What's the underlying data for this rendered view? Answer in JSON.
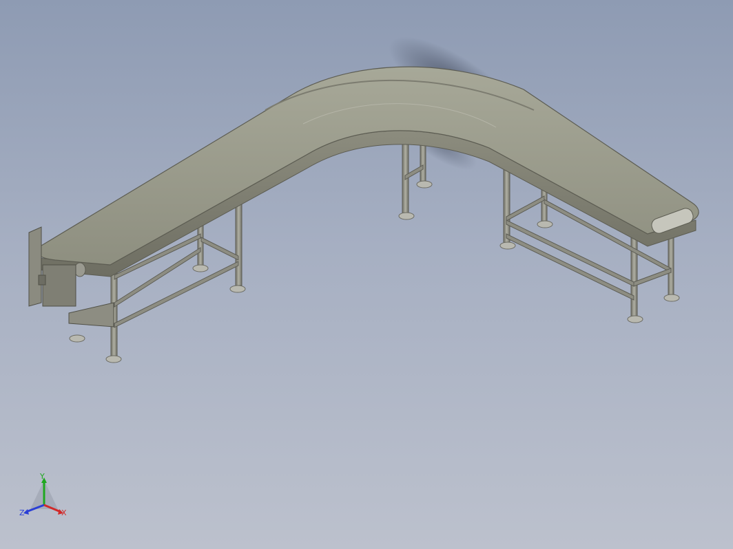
{
  "viewport": {
    "background_top": "#8e9bb3",
    "background_bottom": "#bcc1cd"
  },
  "model": {
    "description_icon": "curved-belt-conveyor-model",
    "frame_color": "#8a8a80",
    "belt_color": "#9a9a8a"
  },
  "triad": {
    "y_label": "Y",
    "z_label": "Z",
    "x_label": "X",
    "y_color": "#1fa81f",
    "z_color": "#2a3fd6",
    "x_color": "#d12a2a"
  }
}
